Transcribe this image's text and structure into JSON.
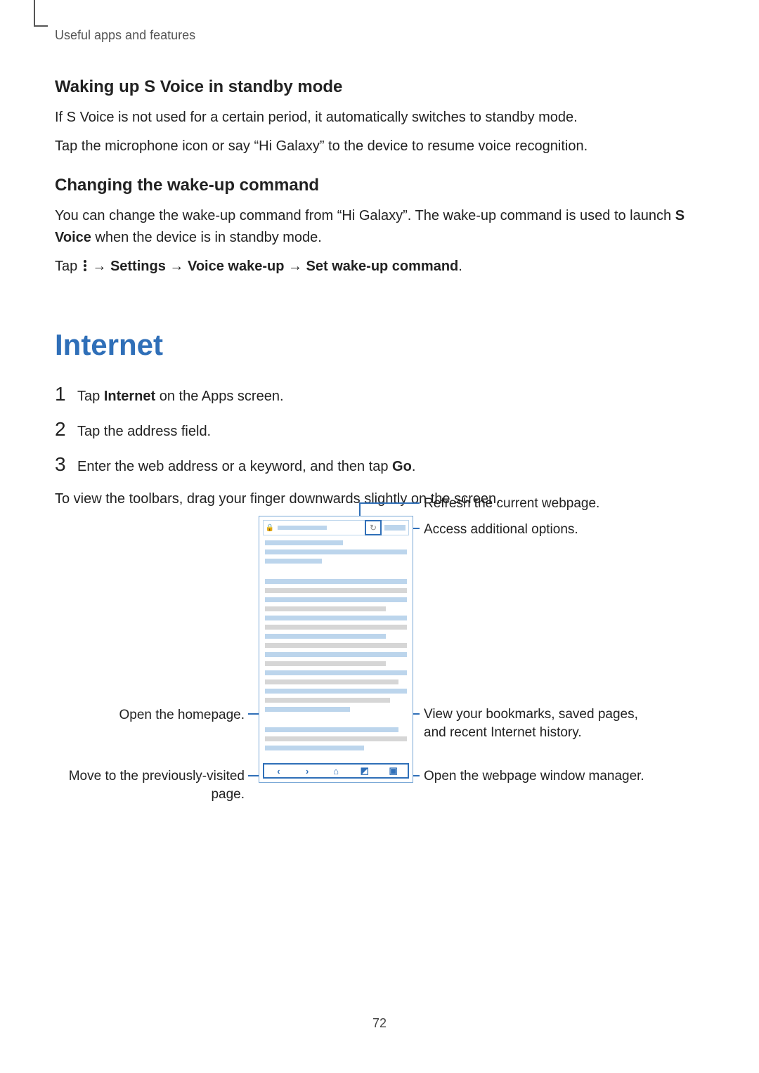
{
  "header": {
    "breadcrumb": "Useful apps and features"
  },
  "section1": {
    "heading": "Waking up S Voice in standby mode",
    "p1": "If S Voice is not used for a certain period, it automatically switches to standby mode.",
    "p2": "Tap the microphone icon or say “Hi Galaxy” to the device to resume voice recognition."
  },
  "section2": {
    "heading": "Changing the wake-up command",
    "p1_a": "You can change the wake-up command from “Hi Galaxy”. The wake-up command is used to launch ",
    "p1_b": "S Voice",
    "p1_c": " when the device is in standby mode.",
    "p2_tap": "Tap ",
    "p2_arrow1": " → ",
    "p2_settings": "Settings",
    "p2_arrow2": " → ",
    "p2_vwu": "Voice wake-up",
    "p2_arrow3": " → ",
    "p2_swc": "Set wake-up command",
    "p2_dot": "."
  },
  "internet": {
    "title": "Internet",
    "step1_a": "Tap ",
    "step1_b": "Internet",
    "step1_c": " on the Apps screen.",
    "step2": "Tap the address field.",
    "step3_a": "Enter the web address or a keyword, and then tap ",
    "step3_b": "Go",
    "step3_c": ".",
    "closing": "To view the toolbars, drag your finger downwards slightly on the screen."
  },
  "step_numbers": {
    "n1": "1",
    "n2": "2",
    "n3": "3"
  },
  "callouts": {
    "refresh": "Refresh the current webpage.",
    "more": "Access additional options.",
    "bookmarks": "View your bookmarks, saved pages, and recent Internet history.",
    "windows": "Open the webpage window manager.",
    "home": "Open the homepage.",
    "back": "Move to the previously-visited page."
  },
  "icons": {
    "lock": "🔒",
    "refresh": "↻",
    "back": "‹",
    "forward": "›",
    "home": "⌂",
    "bookmark": "◩",
    "windows": "▣"
  },
  "page_number": "72"
}
